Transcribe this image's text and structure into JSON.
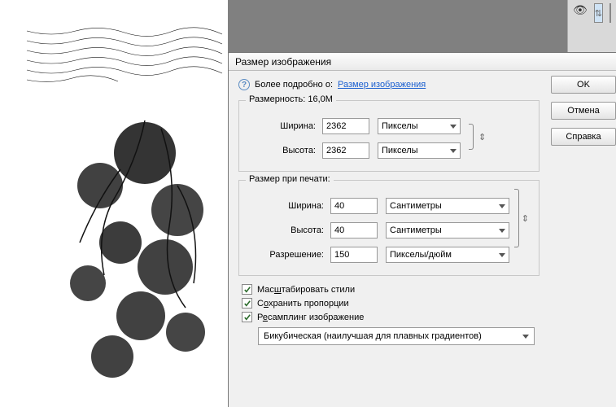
{
  "panel": {
    "eye": "👁",
    "link": "⇅"
  },
  "dialog": {
    "title": "Размер изображения",
    "hint_prefix": "Более подробно о:",
    "hint_link": "Размер изображения",
    "dimensions": {
      "title_prefix": "Размерность:",
      "size": "16,0M",
      "width_label": "Ширина:",
      "width_value": "2362",
      "width_unit": "Пикселы",
      "height_label": "Высота:",
      "height_value": "2362",
      "height_unit": "Пикселы"
    },
    "print": {
      "title": "Размер при печати:",
      "width_label": "Ширина:",
      "width_value": "40",
      "width_unit": "Сантиметры",
      "height_label": "Высота:",
      "height_value": "40",
      "height_unit": "Сантиметры",
      "res_label": "Разрешение:",
      "res_value": "150",
      "res_unit": "Пикселы/дюйм"
    },
    "scale_styles_label_pre": "Мас",
    "scale_styles_label_u": "ш",
    "scale_styles_label_post": "табировать стили",
    "constrain_label_pre": "С",
    "constrain_label_u": "о",
    "constrain_label_post": "хранить пропорции",
    "resample_label_pre": "Р",
    "resample_label_u": "е",
    "resample_label_post": "самплинг изображение",
    "resample_method": "Бикубическая (наилучшая для плавных градиентов)",
    "buttons": {
      "ok": "OK",
      "cancel": "Отмена",
      "help": "Справка"
    },
    "link_glyph": "⇕"
  }
}
